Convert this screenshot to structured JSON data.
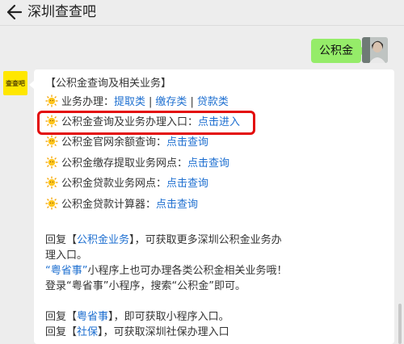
{
  "header": {
    "title": "深圳查查吧",
    "back_icon": "back-arrow-icon"
  },
  "my_message": {
    "text": "公积金"
  },
  "bot": {
    "avatar_text": "查查吧"
  },
  "card": {
    "heading": "【公积金查询及相关业务】",
    "items": [
      {
        "label": "业务办理：",
        "links": [
          "提取类",
          "缴存类",
          "贷款类"
        ],
        "sep": "|"
      },
      {
        "label": "公积金查询及业务办理入口：",
        "link": "点击进入"
      },
      {
        "label": "公积金官网余额查询：",
        "link": "点击查询"
      },
      {
        "label": "公积金缴存提取业务网点：",
        "link": "点击查询"
      },
      {
        "label": "公积金贷款业务网点：",
        "link": "点击查询"
      },
      {
        "label": "公积金贷款计算器：",
        "link": "点击查询"
      }
    ],
    "para1": {
      "pre": "回复",
      "lb": "【",
      "kw": "公积金业务",
      "rb": "】",
      "post": "，可获取更多深圳公积金业务办理入口。"
    },
    "para2": {
      "q1": "“粤省事”",
      "post": "小程序上也可办理各类公积金相关业务哦！登录“粤省事”小程序，搜索“公积金”即可。"
    },
    "para3": {
      "pre": "回复",
      "lb": "【",
      "kw": "粤省事",
      "rb": "】",
      "post": "，即可获取小程序入口。"
    },
    "para4": {
      "pre": "回复",
      "lb": "【",
      "kw": "社保",
      "rb": "】",
      "post": "，可获取深圳社保办理入口"
    }
  },
  "colors": {
    "accent_link": "#1e6fd0",
    "highlight": "#e30a0a",
    "my_bubble": "#95ec69"
  }
}
